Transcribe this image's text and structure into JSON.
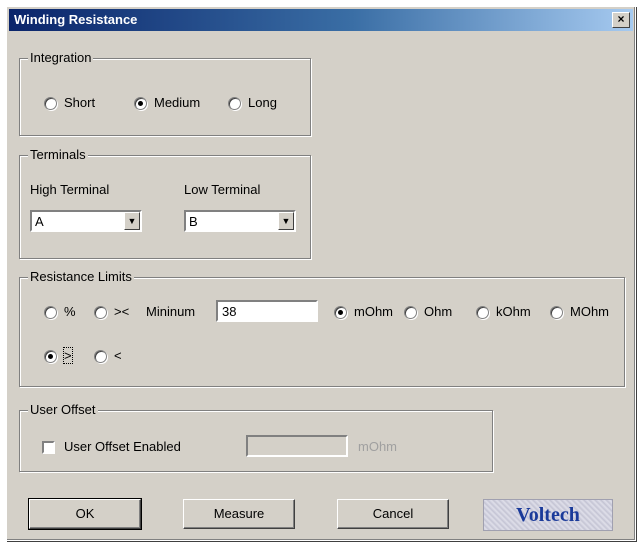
{
  "window": {
    "title": "Winding Resistance",
    "close_glyph": "×"
  },
  "integration": {
    "legend": "Integration",
    "options": [
      {
        "label": "Short",
        "selected": false
      },
      {
        "label": "Medium",
        "selected": true
      },
      {
        "label": "Long",
        "selected": false
      }
    ]
  },
  "terminals": {
    "legend": "Terminals",
    "high_label": "High Terminal",
    "high_value": "A",
    "low_label": "Low Terminal",
    "low_value": "B"
  },
  "limits": {
    "legend": "Resistance Limits",
    "mode_percent": "%",
    "mode_range": "><",
    "minimum_label": "Mininum",
    "minimum_value": "38",
    "units": [
      {
        "label": "mOhm",
        "selected": true
      },
      {
        "label": "Ohm",
        "selected": false
      },
      {
        "label": "kOhm",
        "selected": false
      },
      {
        "label": "MOhm",
        "selected": false
      }
    ],
    "compare": [
      {
        "label": ">",
        "selected": true
      },
      {
        "label": "<",
        "selected": false
      }
    ]
  },
  "offset": {
    "legend": "User Offset",
    "checkbox_label": "User Offset Enabled",
    "enabled": false,
    "value": "",
    "unit": "mOhm"
  },
  "buttons": {
    "ok": "OK",
    "measure": "Measure",
    "cancel": "Cancel"
  },
  "logo": {
    "text": "Voltech"
  }
}
